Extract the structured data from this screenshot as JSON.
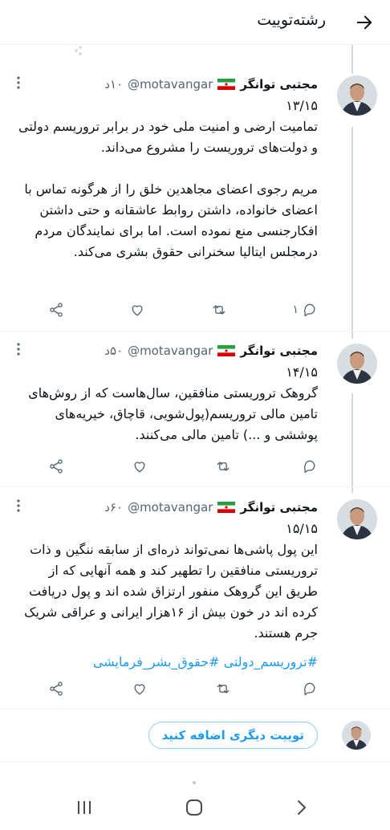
{
  "header": {
    "title": "رشته‌توییت"
  },
  "tweets": [
    {
      "name": "مجتبی توانگر",
      "handle": "@motavangar",
      "time": "۱۰د",
      "counter": "۱۳/۱۵",
      "text": "تمامیت ارضی و امنیت ملی خود در برابر تروریسم دولتی و دولت‌های تروریست را مشروع می‌داند.\n\nمریم رجوی اعضای مجاهدین خلق را از هرگونه تماس با اعضای خانواده، داشتن روابط عاشقانه و حتی داشتن افکارجنسی منع نموده است. اما برای نمایندگان مردم درمجلس ایتالیا سخنرانی حقوق بشری می‌کند.",
      "reply_count": "۱"
    },
    {
      "name": "مجتبی توانگر",
      "handle": "@motavangar",
      "time": "۵۰د",
      "counter": "۱۴/۱۵",
      "text": "گروهک تروریستی منافقین، سال‌هاست که از روش‌های تامین مالی تروریسم(پول‌شویی، قاچاق، خیریه‌های پوششی و ...) تامین مالی می‌کنند.",
      "reply_count": ""
    },
    {
      "name": "مجتبی توانگر",
      "handle": "@motavangar",
      "time": "۶۰د",
      "counter": "۱۵/۱۵",
      "text": "این پول پاشی‌ها نمی‌تواند ذره‌ای از سابقه ننگین و ذات تروریستی منافقین را تطهیر کند و همه آنهایی که از طریق این گروهک منفور ارتزاق شده اند و پول دریافت کرده اند در خون بیش از ۱۶هزار ایرانی و عراقی شریک جرم هستند.",
      "hashtags": "#تروریسم_دولتی #حقوق_بشر_فرمایشی",
      "reply_count": ""
    }
  ],
  "composer": {
    "add_label": "توییت دیگری اضافه کنید"
  },
  "colors": {
    "accent": "#1d9bf0",
    "muted": "#536471",
    "line": "#cfd9de"
  },
  "icons": [
    "back-arrow-icon",
    "more-icon",
    "share-icon",
    "like-icon",
    "retweet-icon",
    "reply-icon",
    "iran-flag-icon",
    "nav-recents-icon",
    "nav-home-icon",
    "nav-back-icon"
  ]
}
